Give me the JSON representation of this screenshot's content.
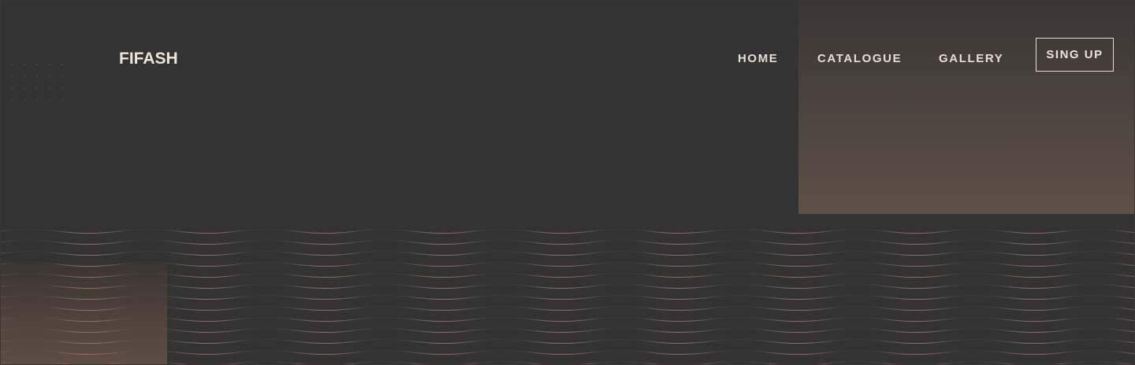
{
  "brand": {
    "logo_text": "FIFASH"
  },
  "nav": {
    "items": [
      {
        "label": "HOME"
      },
      {
        "label": "CATALOGUE"
      },
      {
        "label": "GALLERY"
      }
    ],
    "signup_label": "SING UP"
  },
  "theme": {
    "background": "#333333",
    "text": "#EEE3D8",
    "accent_gradient_top": "#3A3534",
    "accent_gradient_bottom": "#5D5047",
    "wave_line": "#8A6E62"
  },
  "decorations": {
    "dot_grid": "dot-grid-pattern",
    "wave_lines": "wavy-lines-pattern"
  }
}
